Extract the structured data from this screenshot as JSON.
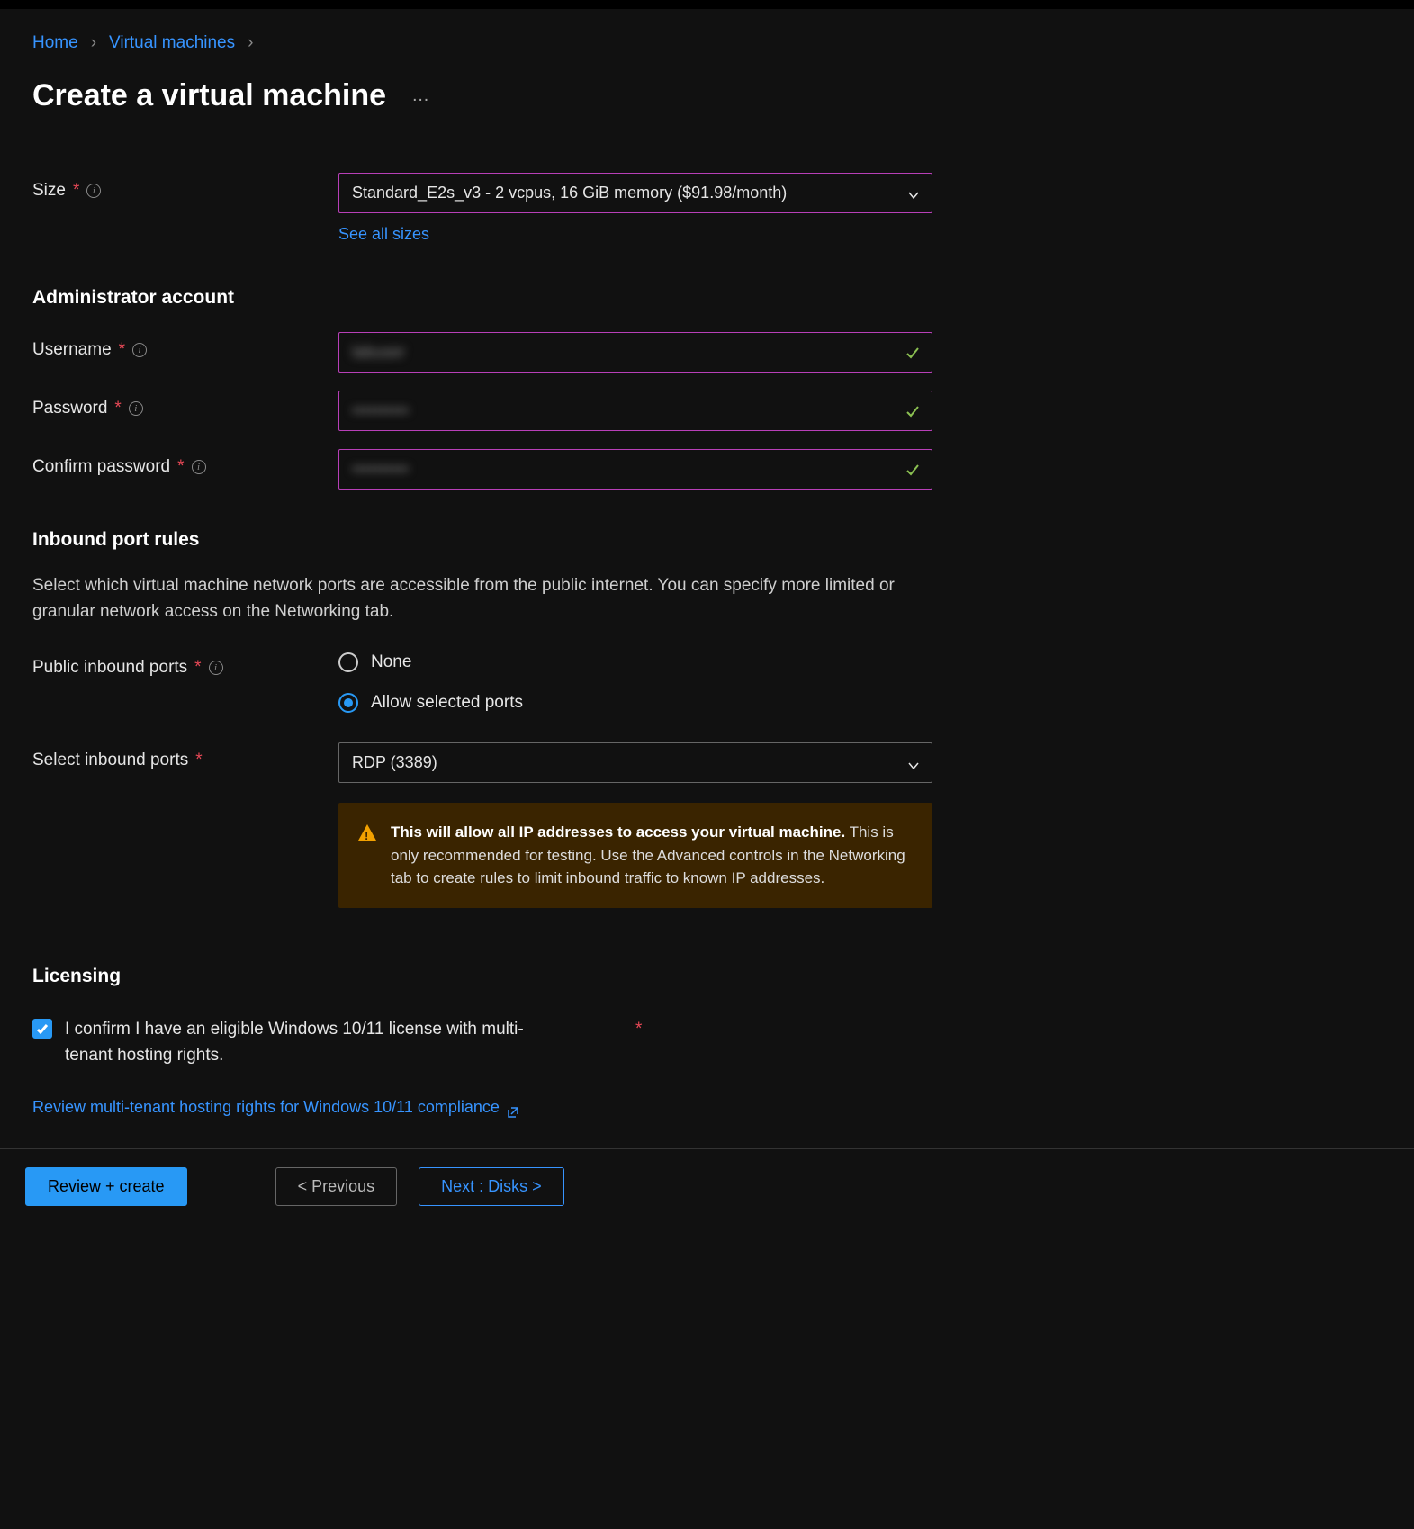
{
  "breadcrumb": {
    "home": "Home",
    "vm": "Virtual machines"
  },
  "page_title": "Create a virtual machine",
  "size": {
    "label": "Size",
    "value": "Standard_E2s_v3 - 2 vcpus, 16 GiB memory ($91.98/month)",
    "link": "See all sizes"
  },
  "admin": {
    "heading": "Administrator account",
    "username_label": "Username",
    "username_value": "labuser",
    "password_label": "Password",
    "password_value": "••••••••••",
    "confirm_label": "Confirm password",
    "confirm_value": "••••••••••"
  },
  "inbound": {
    "heading": "Inbound port rules",
    "desc": "Select which virtual machine network ports are accessible from the public internet. You can specify more limited or granular network access on the Networking tab.",
    "public_label": "Public inbound ports",
    "radio_none": "None",
    "radio_allow": "Allow selected ports",
    "select_label": "Select inbound ports",
    "select_value": "RDP (3389)",
    "warning_bold": "This will allow all IP addresses to access your virtual machine.",
    "warning_rest": "  This is only recommended for testing.  Use the Advanced controls in the Networking tab to create rules to limit inbound traffic to known IP addresses."
  },
  "licensing": {
    "heading": "Licensing",
    "checkbox_label": "I confirm I have an eligible Windows 10/11 license with multi-tenant hosting rights.",
    "link": "Review multi-tenant hosting rights for Windows 10/11 compliance"
  },
  "footer": {
    "review": "Review + create",
    "prev": "< Previous",
    "next": "Next : Disks >"
  }
}
